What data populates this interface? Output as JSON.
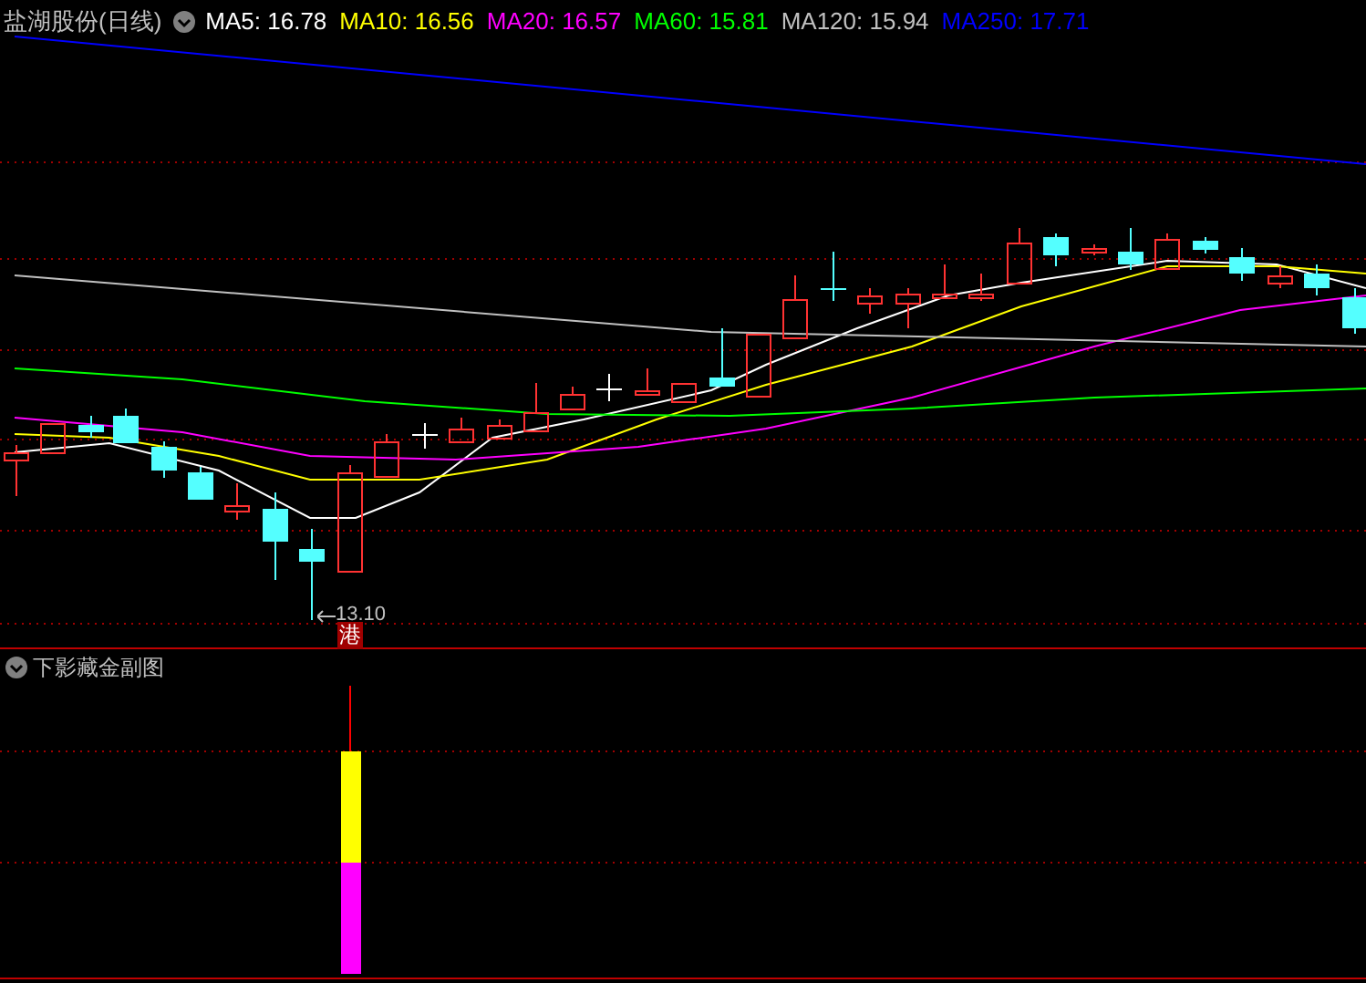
{
  "main_chart": {
    "title": "盐湖股份(日线)",
    "legend": [
      {
        "label": "MA5: 16.78",
        "color": "#ffffff"
      },
      {
        "label": "MA10: 16.56",
        "color": "#ffff00"
      },
      {
        "label": "MA20: 16.57",
        "color": "#ff00ff"
      },
      {
        "label": "MA60: 15.81",
        "color": "#00ff00"
      },
      {
        "label": "MA120: 15.94",
        "color": "#c0c0c0"
      },
      {
        "label": "MA250: 17.71",
        "color": "#0000ff"
      }
    ],
    "low_marker": "13.10",
    "badge": "港"
  },
  "sub_chart": {
    "title": "下影藏金副图"
  }
}
